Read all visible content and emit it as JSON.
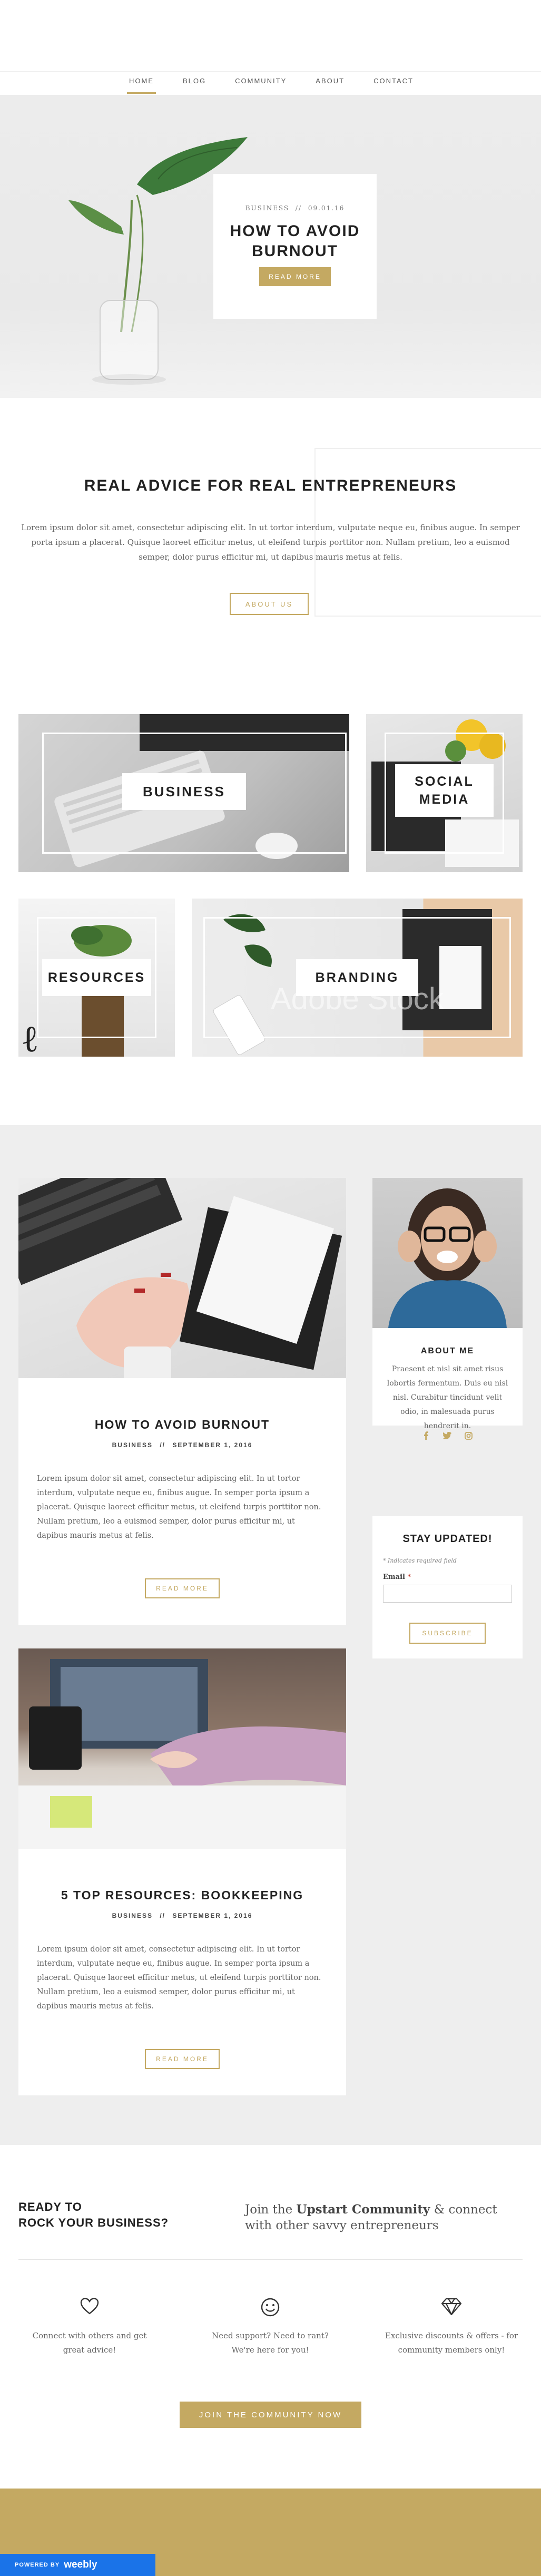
{
  "nav": {
    "items": [
      {
        "label": "HOME"
      },
      {
        "label": "BLOG"
      },
      {
        "label": "COMMUNITY"
      },
      {
        "label": "ABOUT"
      },
      {
        "label": "CONTACT"
      }
    ]
  },
  "hero": {
    "meta_category": "BUSINESS",
    "meta_sep": "//",
    "meta_date": "09.01.16",
    "title_line1": "HOW TO AVOID",
    "title_line2": "BURNOUT",
    "button": "READ MORE"
  },
  "intro": {
    "title": "REAL ADVICE FOR REAL ENTREPRENEURS",
    "text": "Lorem ipsum dolor sit amet, consectetur adipiscing elit. In ut tortor interdum, vulputate neque eu, finibus augue. In semper porta ipsum a placerat. Quisque laoreet efficitur metus, ut eleifend turpis porttitor non. Nullam pretium, leo a euismod semper, dolor purus efficitur mi, ut dapibus mauris metus at felis.",
    "button": "ABOUT US"
  },
  "categories": {
    "business": "BUSINESS",
    "social_line1": "SOCIAL",
    "social_line2": "MEDIA",
    "resources": "RESOURCES",
    "branding": "BRANDING",
    "watermark": "Adobe Stock"
  },
  "posts": [
    {
      "title": "HOW TO AVOID BURNOUT",
      "category": "BUSINESS",
      "sep": "//",
      "date": "SEPTEMBER 1, 2016",
      "excerpt": "Lorem ipsum dolor sit amet, consectetur adipiscing elit. In ut tortor interdum, vulputate neque eu, finibus augue. In semper porta ipsum a placerat. Quisque laoreet efficitur metus, ut eleifend turpis porttitor non. Nullam pretium, leo a euismod semper, dolor purus efficitur mi, ut dapibus mauris metus at felis.",
      "button": "READ MORE"
    },
    {
      "title": "5 TOP RESOURCES: BOOKKEEPING",
      "category": "BUSINESS",
      "sep": "//",
      "date": "SEPTEMBER 1, 2016",
      "excerpt": "Lorem ipsum dolor sit amet, consectetur adipiscing elit. In ut tortor interdum, vulputate neque eu, finibus augue. In semper porta ipsum a placerat. Quisque laoreet efficitur metus, ut eleifend turpis porttitor non. Nullam pretium, leo a euismod semper, dolor purus efficitur mi, ut dapibus mauris metus at felis.",
      "button": "READ MORE"
    }
  ],
  "about": {
    "title": "ABOUT ME",
    "text": "Praesent et nisl sit amet risus lobortis fermentum. Duis eu nisl nisl. Curabitur tincidunt velit odio, in malesuada purus hendrerit in."
  },
  "newsletter": {
    "title": "STAY UPDATED!",
    "required_note": "* Indicates required field",
    "email_label": "Email",
    "email_required": "*",
    "button": "SUBSCRIBE"
  },
  "community": {
    "ready_line1": "READY TO",
    "ready_line2": "ROCK YOUR BUSINESS?",
    "join_prefix": "Join the ",
    "join_bold": "Upstart Community",
    "join_suffix": " & connect",
    "join_line2": "with other savvy entrepreneurs",
    "features": [
      {
        "icon": "heart-icon",
        "line1": "Connect with others and get",
        "line2": "great advice!"
      },
      {
        "icon": "smile-icon",
        "line1": "Need support? Need to rant?",
        "line2": "We're here for you!"
      },
      {
        "icon": "diamond-icon",
        "line1": "Exclusive discounts & offers - for",
        "line2": "community members only!"
      }
    ],
    "button": "JOIN THE COMMUNITY NOW"
  },
  "footer": {
    "powered_by": "POWERED BY",
    "brand": "weebly"
  },
  "colors": {
    "accent": "#c4a962",
    "nav_underline": "#c4a962",
    "footer_bg": "#c4a962",
    "badge_bg": "#1a73e8"
  }
}
